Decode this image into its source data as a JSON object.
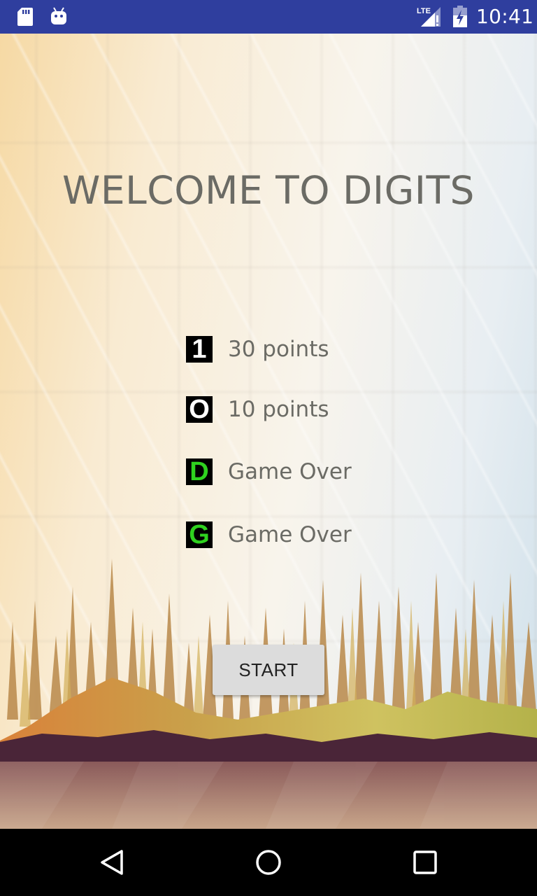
{
  "status_bar": {
    "time": "10:41",
    "network_label": "LTE",
    "icons": [
      "sd-card-icon",
      "android-bot-icon",
      "lte-signal-icon",
      "battery-charging-icon"
    ],
    "background_color": "#2f3e9e"
  },
  "main": {
    "title": "WELCOME TO DIGITS",
    "legend": [
      {
        "symbol": "1",
        "symbol_color": "#ffffff",
        "description": "30 points"
      },
      {
        "symbol": "O",
        "symbol_color": "#ffffff",
        "description": "10 points"
      },
      {
        "symbol": "D",
        "symbol_color": "#2fd21f",
        "description": "Game Over"
      },
      {
        "symbol": "G",
        "symbol_color": "#2fd21f",
        "description": "Game Over"
      }
    ],
    "start_label": "START"
  },
  "nav_bar": {
    "buttons": [
      "back-icon",
      "home-icon",
      "recent-apps-icon"
    ]
  }
}
